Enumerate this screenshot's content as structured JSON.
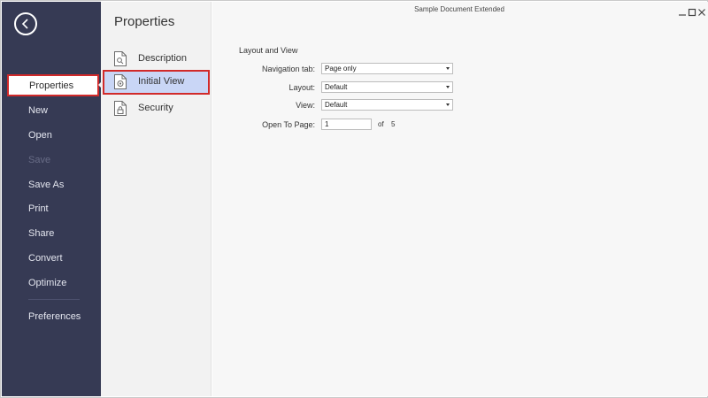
{
  "window": {
    "document_title": "Sample Document Extended",
    "controls": [
      "minimize",
      "maximize",
      "close"
    ]
  },
  "sidebar": {
    "items": [
      {
        "label": "Properties",
        "selected": true
      },
      {
        "label": "New"
      },
      {
        "label": "Open"
      },
      {
        "label": "Save",
        "disabled": true
      },
      {
        "label": "Save As"
      },
      {
        "label": "Print"
      },
      {
        "label": "Share"
      },
      {
        "label": "Convert"
      },
      {
        "label": "Optimize"
      },
      {
        "label": "Preferences"
      }
    ]
  },
  "middle": {
    "title": "Properties",
    "items": [
      {
        "label": "Description",
        "icon": "document-search-icon"
      },
      {
        "label": "Initial View",
        "icon": "document-view-icon",
        "selected": true
      },
      {
        "label": "Security",
        "icon": "document-lock-icon"
      }
    ]
  },
  "content": {
    "section_title": "Layout and View",
    "fields": {
      "navigation_tab": {
        "label": "Navigation tab:",
        "value": "Page only"
      },
      "layout": {
        "label": "Layout:",
        "value": "Default"
      },
      "view": {
        "label": "View:",
        "value": "Default"
      },
      "open_to_page": {
        "label": "Open To Page:",
        "value": "1",
        "of_label": "of",
        "total": "5"
      }
    }
  },
  "colors": {
    "sidebar_bg": "#363a54",
    "middle_bg": "#f2f2f2",
    "content_bg": "#f7f7f7",
    "selection_bg": "#c9d6f6",
    "highlight_border": "#d12a2a"
  }
}
